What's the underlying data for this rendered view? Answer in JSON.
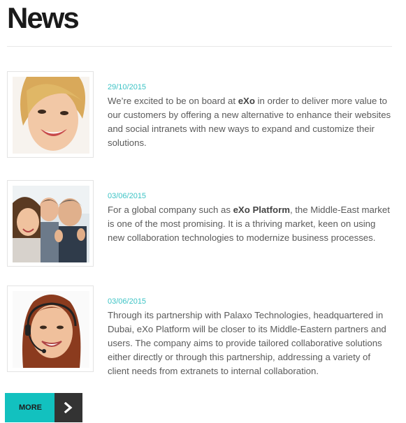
{
  "page": {
    "title": "News"
  },
  "news": [
    {
      "date": "29/10/2015",
      "text_before": "We’re excited to be on board at ",
      "highlight": "eXo",
      "text_after": " in order to deliver more value to our customers by offering a new alternative to enhance their websites and social intranets with new ways to expand and customize their solutions."
    },
    {
      "date": "03/06/2015",
      "text_before": "For a global company such as ",
      "highlight": "eXo Platform",
      "text_after": ", the Middle-East market is one of the most promising. It is a thriving market, keen on using new collaboration technologies to modernize business processes."
    },
    {
      "date": "03/06/2015",
      "text_before": "Through its partnership with Palaxo Technologies, headquartered in Dubai, eXo Platform will be closer to its Middle-Eastern partners and users. The company aims to provide tailored collaborative solutions either directly or through this partnership, addressing a variety of client needs from extranets to internal collaboration.",
      "highlight": "",
      "text_after": ""
    }
  ],
  "more_button": {
    "label": "MORE",
    "icon": "chevron-right-icon"
  },
  "colors": {
    "accent": "#12c1bf",
    "date": "#3cc3c5",
    "arrow_bg": "#333333"
  }
}
